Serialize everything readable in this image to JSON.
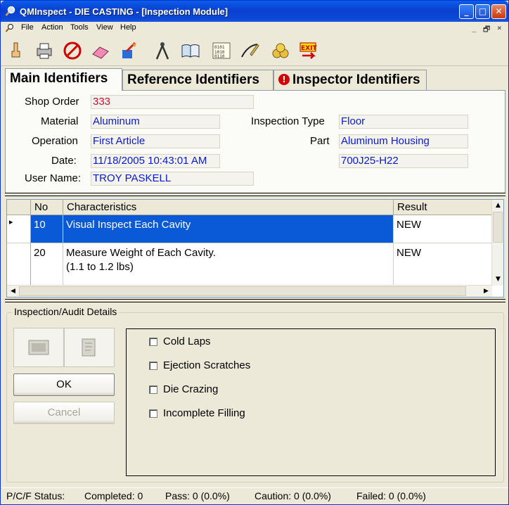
{
  "window": {
    "title": "QMInspect - DIE CASTING - [Inspection Module]",
    "controls": {
      "minimize": "_",
      "maximize": "□",
      "close": "✕"
    }
  },
  "menu": {
    "items": [
      "File",
      "Action",
      "Tools",
      "View",
      "Help"
    ],
    "mdi_controls": [
      "_",
      "🗗",
      "×"
    ]
  },
  "toolbar": {
    "icons": [
      "pointer-icon",
      "printer-icon",
      "no-symbol-icon",
      "eraser-icon",
      "paint-brush-icon",
      "compass-icon",
      "book-icon",
      "binary-data-icon",
      "pen-icon",
      "coins-icon",
      "exit-icon"
    ],
    "exit_label": "EXIT"
  },
  "tabs": [
    {
      "label": "Main Identifiers",
      "active": true
    },
    {
      "label": "Reference Identifiers",
      "active": false
    },
    {
      "label": "Inspector Identifiers",
      "active": false,
      "warning": "!"
    }
  ],
  "identifiers": {
    "shop_order": {
      "label": "Shop Order",
      "value": "333"
    },
    "material": {
      "label": "Material",
      "value": "Aluminum"
    },
    "operation": {
      "label": "Operation",
      "value": "First Article"
    },
    "date": {
      "label": "Date:",
      "value": "11/18/2005 10:43:01 AM"
    },
    "user_name": {
      "label": "User Name:",
      "value": "TROY PASKELL"
    },
    "inspection_type": {
      "label": "Inspection Type",
      "value": "Floor"
    },
    "part": {
      "label": "Part",
      "value": "Aluminum Housing"
    },
    "part_number": {
      "value": "700J25-H22"
    }
  },
  "grid": {
    "columns": [
      "No",
      "Characteristics",
      "Result"
    ],
    "rows": [
      {
        "no": "10",
        "characteristic": "Visual Inspect Each Cavity",
        "result": "NEW",
        "selected": true
      },
      {
        "no": "20",
        "characteristic": "Measure Weight of Each Cavity.\n(1.1 to 1.2 lbs)",
        "result": "NEW",
        "selected": false
      }
    ],
    "row_indicator": "▸"
  },
  "details": {
    "title": "Inspection/Audit Details",
    "ok_label": "OK",
    "cancel_label": "Cancel",
    "checkboxes": [
      "Cold Laps",
      "Ejection Scratches",
      "Die Crazing",
      "Incomplete Filling"
    ]
  },
  "status": {
    "label": "P/C/F Status:",
    "completed": "Completed: 0",
    "pass": "Pass: 0 (0.0%)",
    "caution": "Caution: 0 (0.0%)",
    "failed": "Failed: 0 (0.0%)"
  },
  "colors": {
    "selection": "#0a59d6",
    "value_text": "#0a1ad0",
    "shop_order_text": "#c8102e",
    "warning": "#d40000"
  }
}
